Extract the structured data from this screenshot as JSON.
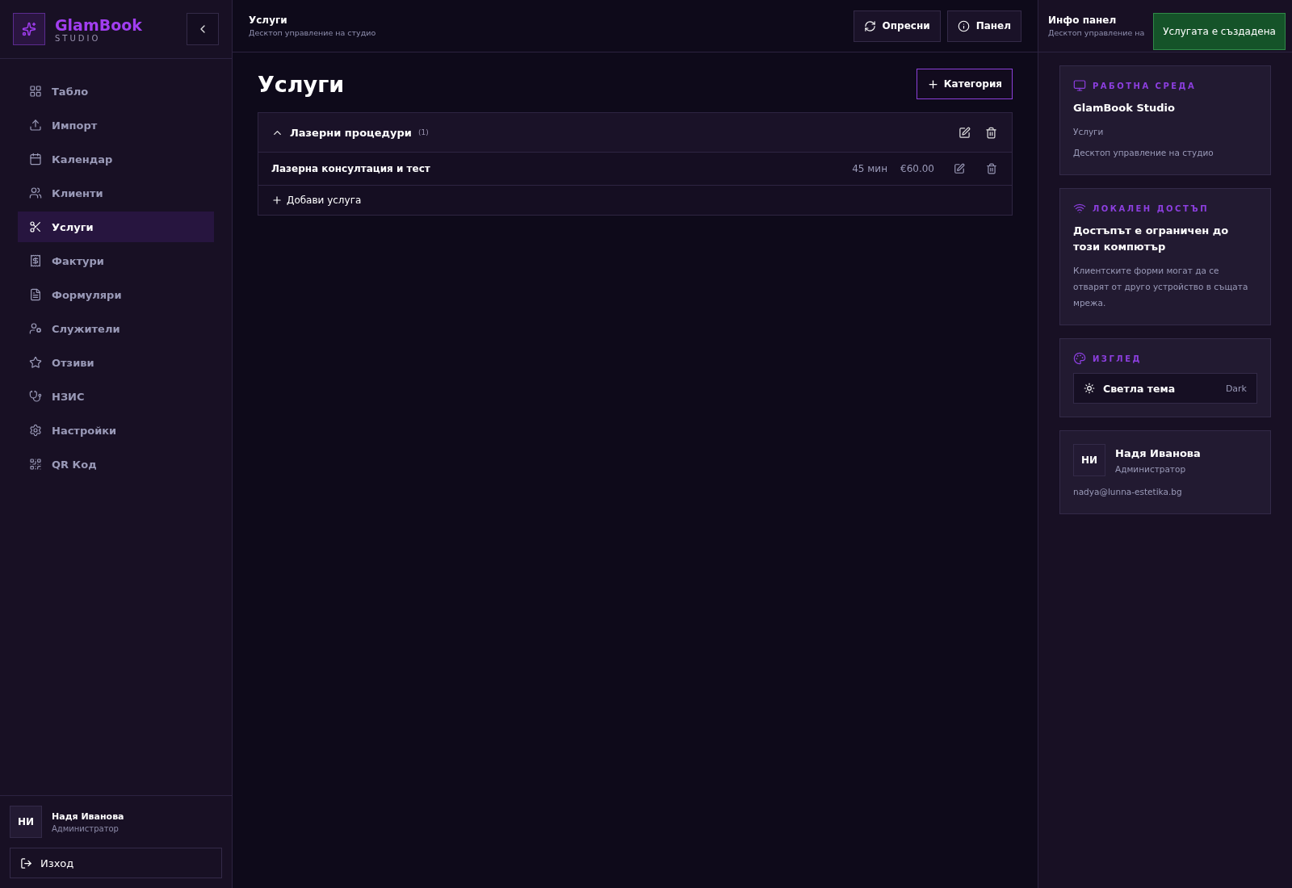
{
  "brand": {
    "name": "GlamBook",
    "subtitle": "STUDIO"
  },
  "nav": [
    {
      "label": "Табло",
      "selected": false
    },
    {
      "label": "Импорт",
      "selected": false
    },
    {
      "label": "Календар",
      "selected": false
    },
    {
      "label": "Клиенти",
      "selected": false
    },
    {
      "label": "Услуги",
      "selected": true
    },
    {
      "label": "Фактури",
      "selected": false
    },
    {
      "label": "Формуляри",
      "selected": false
    },
    {
      "label": "Служители",
      "selected": false
    },
    {
      "label": "Отзиви",
      "selected": false
    },
    {
      "label": "НЗИС",
      "selected": false
    },
    {
      "label": "Настройки",
      "selected": false
    },
    {
      "label": "QR Код",
      "selected": false
    }
  ],
  "sidebar_user": {
    "initials": "НИ",
    "name": "Надя Иванова",
    "role": "Администратор",
    "logout": "Изход"
  },
  "header": {
    "title": "Услуги",
    "subtitle": "Десктоп управление на студио",
    "buttons": [
      "Опресни",
      "Панел"
    ]
  },
  "page": {
    "title": "Услуги",
    "add_category": "Категория"
  },
  "categories": [
    {
      "name": "Лазерни процедури",
      "count": "(1)",
      "expanded": true,
      "services": [
        {
          "name": "Лазерна консултация и тест",
          "duration": "45 мин",
          "price": "€60.00"
        }
      ],
      "add_service": "Добави услуга"
    }
  ],
  "info_panel": {
    "title": "Инфо панел",
    "subtitle": "Десктоп управление на",
    "cards": [
      {
        "kind": "workspace",
        "heading": "РАБОТНА СРЕДА",
        "title": "GlamBook Studio",
        "lines": [
          "Услуги",
          "Десктоп управление на студио"
        ]
      },
      {
        "kind": "access",
        "heading": "ЛОКАЛЕН ДОСТЪП",
        "title": "Достъпът е ограничен до този компютър",
        "lines": [
          "Клиентските форми могат да се отварят от друго устройство в същата мрежа."
        ]
      },
      {
        "kind": "theme",
        "heading": "ИЗГЛЕД",
        "toggle": {
          "label": "Светла тема",
          "value": "Dark"
        }
      },
      {
        "kind": "user",
        "initials": "НИ",
        "name": "Надя Иванова",
        "role": "Администратор",
        "email": "nadya@lunna-estetika.bg"
      }
    ]
  },
  "toast": {
    "message": "Услугата е създадена"
  }
}
